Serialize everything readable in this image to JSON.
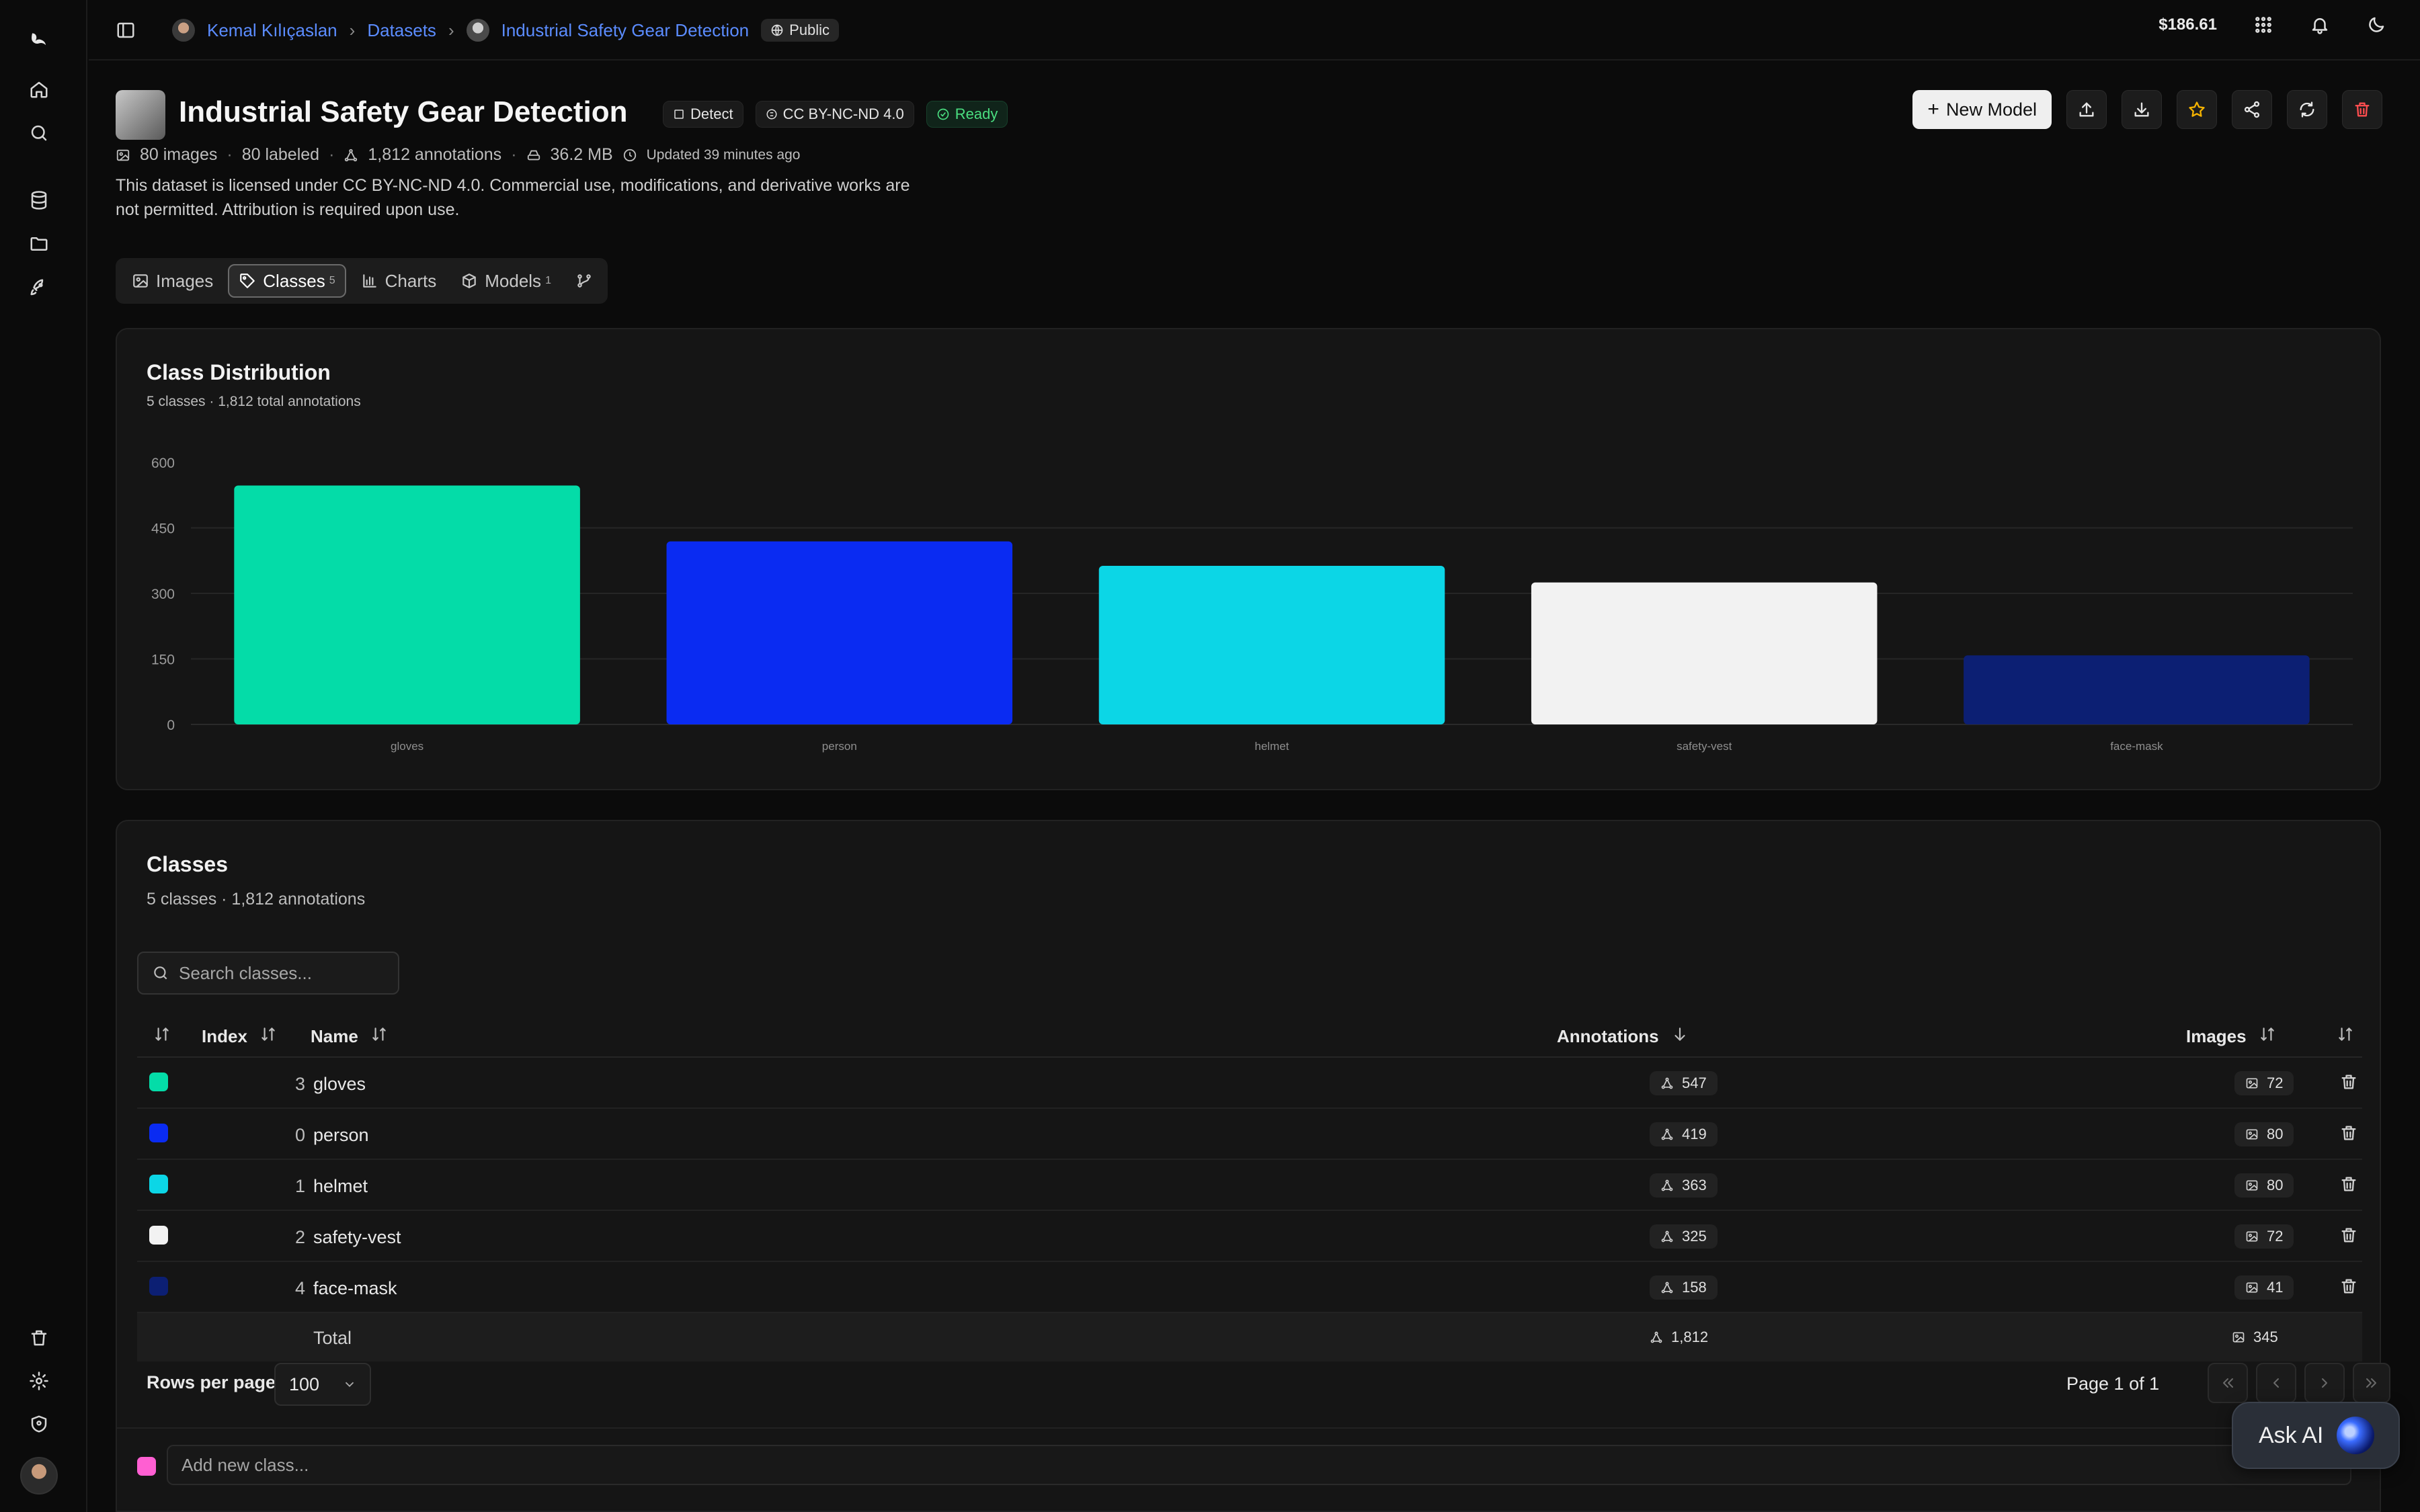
{
  "breadcrumb": {
    "user": "Kemal Kılıçaslan",
    "section": "Datasets",
    "dataset": "Industrial Safety Gear Detection",
    "visibility": "Public"
  },
  "topbar": {
    "balance": "$186.61"
  },
  "header": {
    "title": "Industrial Safety Gear Detection",
    "task_chip": "Detect",
    "license_chip": "CC BY-NC-ND 4.0",
    "status_chip": "Ready",
    "images": "80 images",
    "labeled": "80 labeled",
    "annotations": "1,812 annotations",
    "size": "36.2 MB",
    "updated": "Updated 39 minutes ago",
    "description": "This dataset is licensed under CC BY-NC-ND 4.0. Commercial use, modifications, and derivative works are not permitted. Attribution is required upon use.",
    "new_model_label": "New Model"
  },
  "tabs": [
    {
      "label": "Images",
      "count": ""
    },
    {
      "label": "Classes",
      "count": "5"
    },
    {
      "label": "Charts",
      "count": ""
    },
    {
      "label": "Models",
      "count": "1"
    }
  ],
  "chart_card": {
    "title": "Class Distribution",
    "subtitle": "5 classes · 1,812 total annotations"
  },
  "chart_data": {
    "type": "bar",
    "categories": [
      "gloves",
      "person",
      "helmet",
      "safety-vest",
      "face-mask"
    ],
    "values": [
      547,
      419,
      363,
      325,
      158
    ],
    "colors": [
      "#04dca8",
      "#0a2bf2",
      "#0cd6e6",
      "#f2f2f2",
      "#0c1f73"
    ],
    "yticks": [
      0,
      150,
      300,
      450,
      600
    ],
    "ylim": [
      0,
      600
    ],
    "grid": true
  },
  "classes_card": {
    "title": "Classes",
    "subtitle": "5 classes · 1,812 annotations",
    "search_placeholder": "Search classes...",
    "columns": {
      "index": "Index",
      "name": "Name",
      "annotations": "Annotations",
      "images": "Images"
    },
    "rows": [
      {
        "index": "3",
        "name": "gloves",
        "annotations": "547",
        "images": "72",
        "color": "#04dca8"
      },
      {
        "index": "0",
        "name": "person",
        "annotations": "419",
        "images": "80",
        "color": "#0a2bf2"
      },
      {
        "index": "1",
        "name": "helmet",
        "annotations": "363",
        "images": "80",
        "color": "#0cd6e6"
      },
      {
        "index": "2",
        "name": "safety-vest",
        "annotations": "325",
        "images": "72",
        "color": "#f2f2f2"
      },
      {
        "index": "4",
        "name": "face-mask",
        "annotations": "158",
        "images": "41",
        "color": "#0c1f73"
      }
    ],
    "total": {
      "label": "Total",
      "annotations": "1,812",
      "images": "345"
    },
    "rows_per_page_label": "Rows per page",
    "rows_per_page_value": "100",
    "page_label": "Page 1 of 1",
    "add_placeholder": "Add new class..."
  },
  "ask_ai": "Ask AI"
}
